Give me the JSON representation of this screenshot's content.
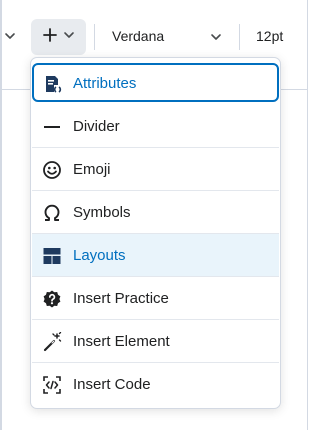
{
  "toolbar": {
    "font_family": "Verdana",
    "font_size": "12pt"
  },
  "menu": {
    "items": [
      {
        "label": "Attributes",
        "icon": "attributes-icon",
        "state": "focused"
      },
      {
        "label": "Divider",
        "icon": "divider-icon"
      },
      {
        "label": "Emoji",
        "icon": "emoji-icon"
      },
      {
        "label": "Symbols",
        "icon": "omega-icon"
      },
      {
        "label": "Layouts",
        "icon": "layouts-icon",
        "state": "hovered"
      },
      {
        "label": "Insert Practice",
        "icon": "practice-icon"
      },
      {
        "label": "Insert Element",
        "icon": "magic-wand-icon"
      },
      {
        "label": "Insert Code",
        "icon": "code-icon"
      }
    ]
  },
  "colors": {
    "accent": "#006fbf",
    "hover_bg": "#e9f4fb",
    "text": "#202122",
    "border": "#d3d9e3"
  }
}
